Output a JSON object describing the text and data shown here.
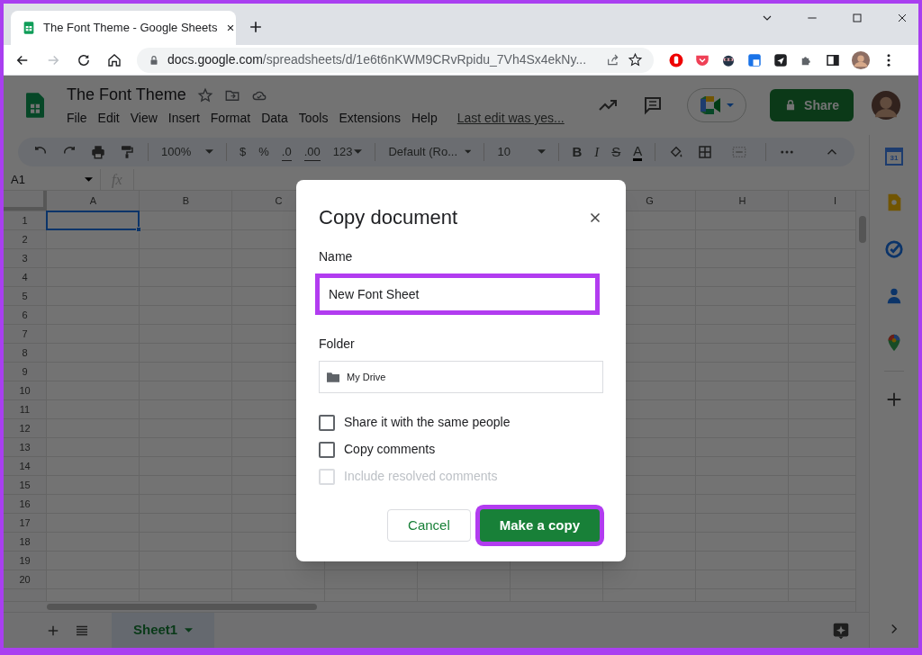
{
  "browser": {
    "tab_title": "The Font Theme - Google Sheets",
    "url_host": "docs.google.com",
    "url_path": "/spreadsheets/d/1e6t6nKWM9CRvRpidu_7Vh4Sx4ekNy..."
  },
  "app": {
    "doc_title": "The Font Theme",
    "menu": [
      "File",
      "Edit",
      "View",
      "Insert",
      "Format",
      "Data",
      "Tools",
      "Extensions",
      "Help"
    ],
    "last_edit": "Last edit was yes...",
    "share_label": "Share"
  },
  "toolbar": {
    "zoom": "100%",
    "currency": "$",
    "percent": "%",
    "decrease_decimals": ".0",
    "increase_decimals": ".00",
    "number_format": "123",
    "font": "Default (Ro...",
    "font_size": "10",
    "bold": "B",
    "italic": "I",
    "strikethrough": "S",
    "text_color": "A"
  },
  "formula_bar": {
    "cell_ref": "A1",
    "fx": "fx"
  },
  "grid": {
    "columns": [
      {
        "label": "A"
      },
      {
        "label": "B"
      },
      {
        "label": "C"
      },
      {},
      {},
      {},
      {
        "label": "G"
      },
      {
        "label": "H"
      },
      {
        "label": "I"
      }
    ],
    "rows": [
      "1",
      "2",
      "3",
      "4",
      "5",
      "6",
      "7",
      "8",
      "9",
      "10",
      "11",
      "12",
      "13",
      "14",
      "15",
      "16",
      "17",
      "18",
      "19",
      "20"
    ]
  },
  "sheet_tabs": [
    {
      "label": "Sheet1",
      "selected": true
    }
  ],
  "side_panel": {
    "calendar_day": "31"
  },
  "dialog": {
    "title": "Copy document",
    "name_label": "Name",
    "name_value": "New Font Sheet",
    "name_highlighted": true,
    "folder_label": "Folder",
    "folder_value": "My Drive",
    "options": [
      {
        "label": "Share it with the same people",
        "checked": false,
        "disabled": false
      },
      {
        "label": "Copy comments",
        "checked": false,
        "disabled": false
      },
      {
        "label": "Include resolved comments",
        "checked": false,
        "disabled": true
      }
    ],
    "buttons": [
      {
        "label": "Cancel",
        "kind": "secondary",
        "highlighted": false
      },
      {
        "label": "Make a copy",
        "kind": "primary",
        "highlighted": true
      }
    ]
  }
}
